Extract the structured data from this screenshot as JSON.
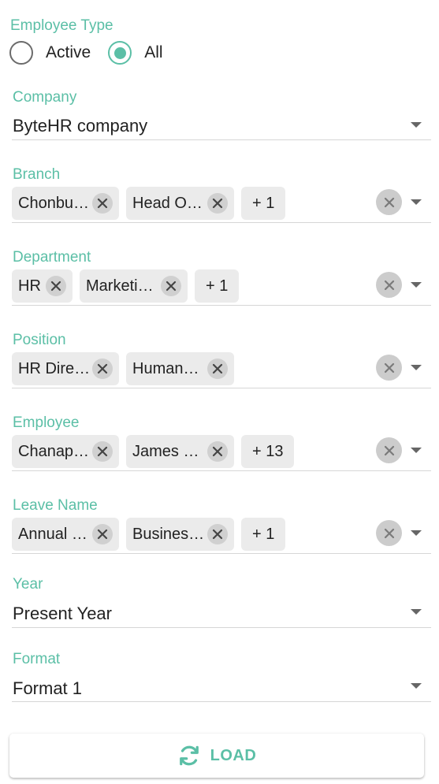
{
  "employee_type": {
    "label": "Employee Type",
    "options": [
      "Active",
      "All"
    ],
    "selected": "All"
  },
  "company": {
    "label": "Company",
    "value": "ByteHR company"
  },
  "branch": {
    "label": "Branch",
    "chips": [
      "Chonbu…",
      "Head O…"
    ],
    "more": "+ 1"
  },
  "department": {
    "label": "Department",
    "chips": [
      "HR",
      "Marketi…"
    ],
    "more": "+ 1"
  },
  "position": {
    "label": "Position",
    "chips": [
      "HR Dire…",
      "Human…"
    ]
  },
  "employee": {
    "label": "Employee",
    "chips": [
      "Chanap…",
      "James …"
    ],
    "more": "+ 13"
  },
  "leave_name": {
    "label": "Leave Name",
    "chips": [
      "Annual …",
      "Busines…"
    ],
    "more": "+ 1"
  },
  "year": {
    "label": "Year",
    "value": "Present Year"
  },
  "format": {
    "label": "Format",
    "value": "Format 1"
  },
  "load_button": {
    "label": "LOAD",
    "icon": "refresh-icon"
  },
  "colors": {
    "accent": "#5bbfa6",
    "chip_bg": "#ebebeb",
    "clear_bg": "#cccccc"
  }
}
